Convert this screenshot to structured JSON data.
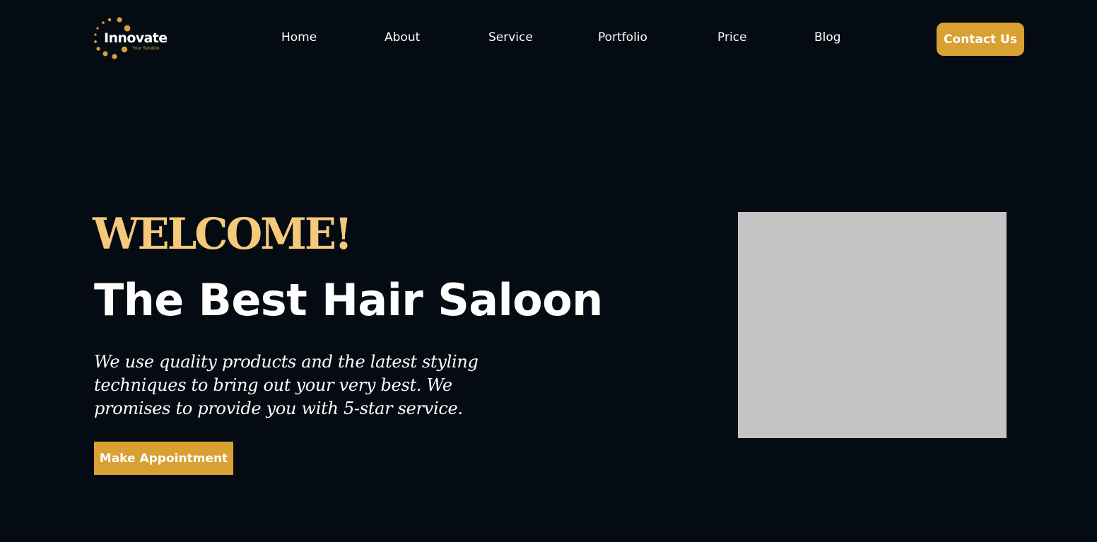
{
  "brand": {
    "name": "Innovate",
    "tagline": "Your Solution",
    "logo_icon": "dotted-circle-logo-icon",
    "accent_color": "#d9a032"
  },
  "nav": {
    "items": [
      {
        "label": "Home"
      },
      {
        "label": "About"
      },
      {
        "label": "Service"
      },
      {
        "label": "Portfolio"
      },
      {
        "label": "Price"
      },
      {
        "label": "Blog"
      }
    ],
    "contact_label": "Contact Us"
  },
  "hero": {
    "welcome": "WELCOME!",
    "headline": "The Best Hair Saloon",
    "description": "We use quality products and the latest styling techniques to bring out your very best. We promises to provide you with 5-star service.",
    "cta_label": "Make Appointment",
    "welcome_color": "#f4c97a",
    "background_color": "#050b12",
    "image_placeholder_color": "#c4c4c4"
  }
}
